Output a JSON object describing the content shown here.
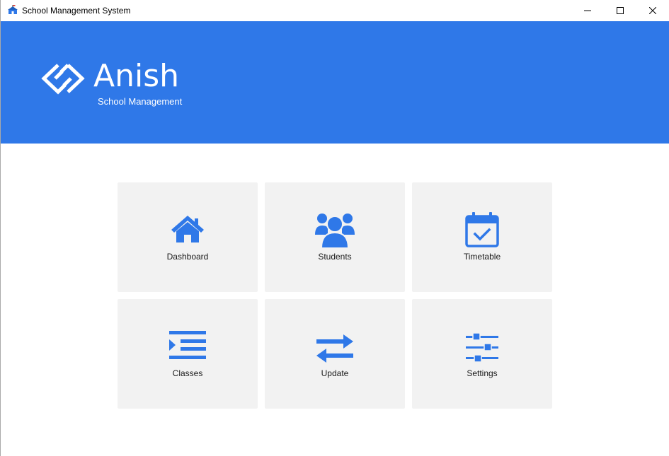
{
  "window": {
    "title": "School Management System"
  },
  "header": {
    "brand": "Anish",
    "subtitle": "School Management"
  },
  "colors": {
    "accent": "#2f78e8",
    "tile_bg": "#f2f2f2",
    "icon": "#2f78e8"
  },
  "tiles": [
    {
      "label": "Dashboard",
      "icon": "home-icon"
    },
    {
      "label": "Students",
      "icon": "users-icon"
    },
    {
      "label": "Timetable",
      "icon": "calendar-check-icon"
    },
    {
      "label": "Classes",
      "icon": "list-indent-icon"
    },
    {
      "label": "Update",
      "icon": "swap-arrows-icon"
    },
    {
      "label": "Settings",
      "icon": "sliders-icon"
    }
  ]
}
